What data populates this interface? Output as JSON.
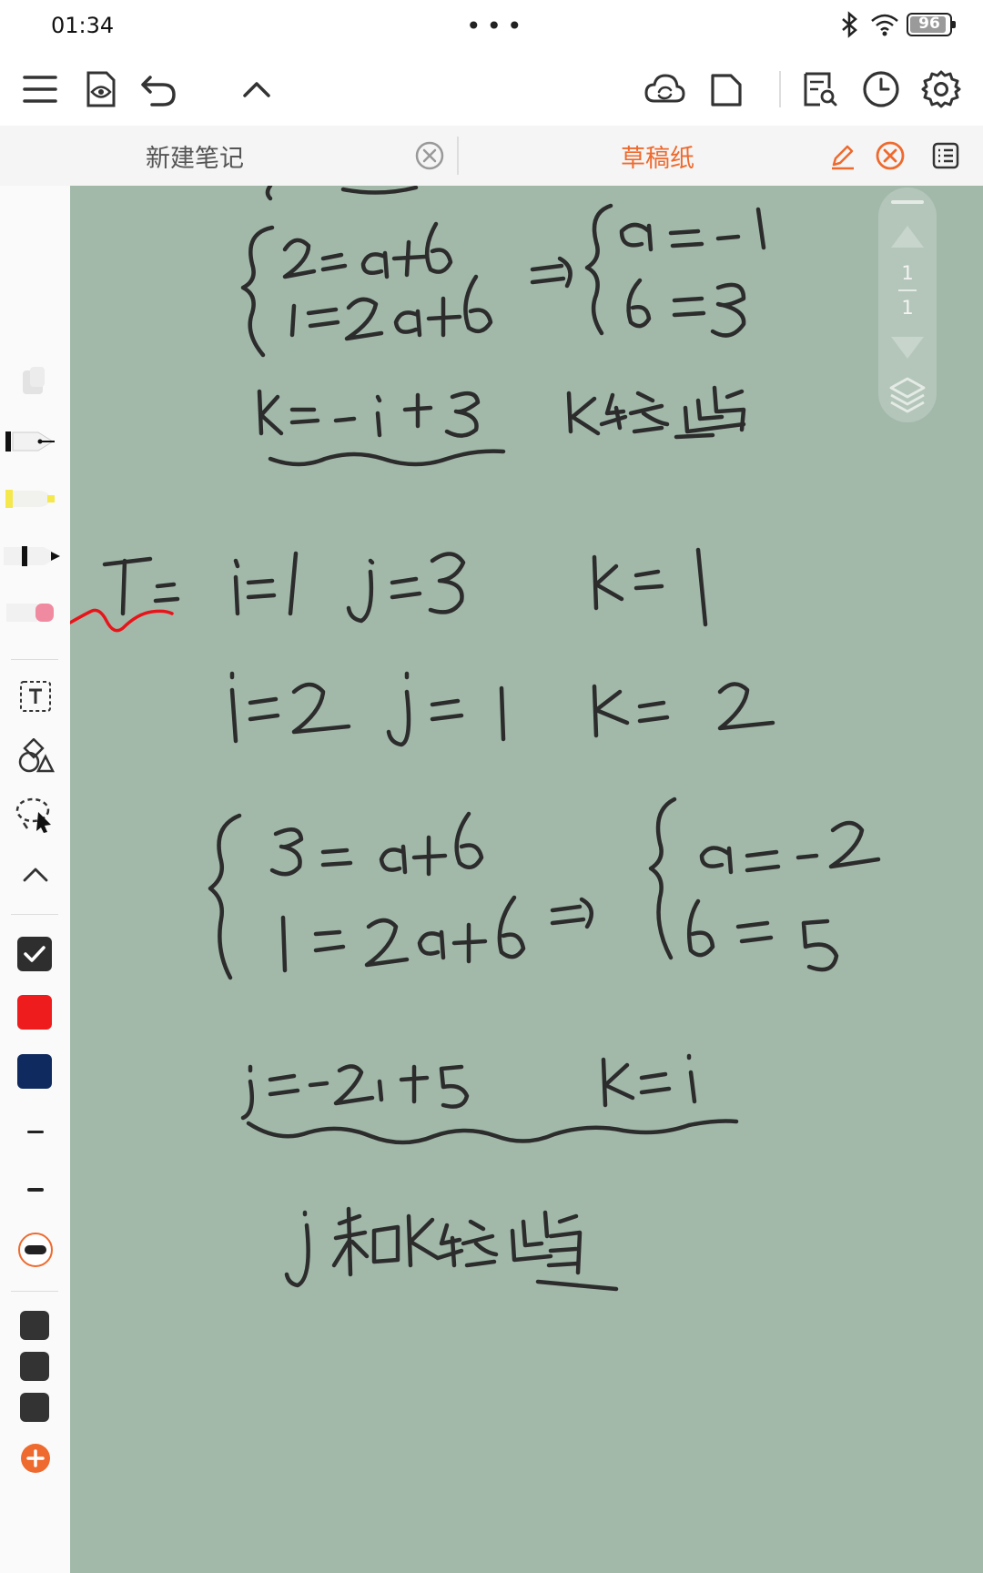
{
  "status_bar": {
    "time": "01:34",
    "battery_level": "96",
    "battery_fraction": 0.96
  },
  "toolbar": {
    "icons": [
      "menu-icon",
      "view-eye-icon",
      "undo-icon",
      "collapse-icon",
      "cloud-sync-icon",
      "page-icon",
      "search-document-icon",
      "history-clock-icon",
      "settings-gear-icon"
    ]
  },
  "tabs": [
    {
      "label": "新建笔记",
      "active": false
    },
    {
      "label": "草稿纸",
      "active": true
    }
  ],
  "page_nav": {
    "current": "1",
    "total": "1"
  },
  "tools": {
    "pens": [
      "fountain-pen-icon",
      "highlighter-icon",
      "marker-pen-icon",
      "eraser-icon"
    ],
    "colors": {
      "selected": "#2e2e2e",
      "red": "#ee1c1c",
      "navy": "#0e2a5e",
      "recent_1": "#333333",
      "recent_2": "#333333",
      "recent_3": "#333333"
    },
    "accent": "#ee6a2e"
  },
  "canvas": {
    "background": "#a2b9aa",
    "ink": "#2c2c2c"
  }
}
